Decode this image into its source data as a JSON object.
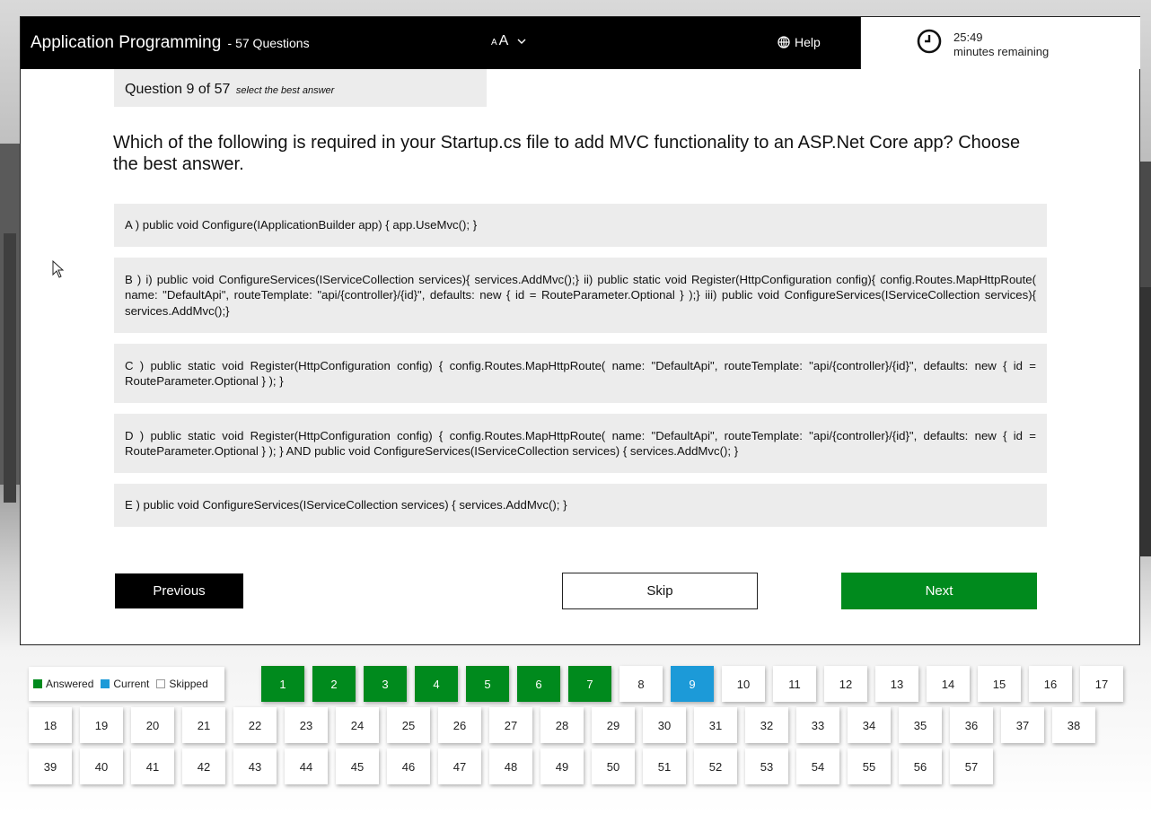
{
  "header": {
    "title": "Application Programming",
    "subtitle": "- 57 Questions",
    "font_size_small": "A",
    "font_size_big": "A",
    "help_label": "Help",
    "timer_value": "25:49",
    "timer_label": "minutes remaining"
  },
  "question": {
    "label": "Question 9 of 57",
    "hint": "select the best answer",
    "text": "Which of the following is required in your Startup.cs file to add MVC functionality to an ASP.Net Core app? Choose the best answer."
  },
  "options": [
    "A ) public void Configure(IApplicationBuilder app) { app.UseMvc(); }",
    "B ) i) public void ConfigureServices(IServiceCollection services){ services.AddMvc();} ii) public static void Register(HttpConfiguration config){ config.Routes.MapHttpRoute( name: \"DefaultApi\", routeTemplate: \"api/{controller}/{id}\", defaults: new { id = RouteParameter.Optional } );} iii) public void ConfigureServices(IServiceCollection services){ services.AddMvc();}",
    "C ) public static void Register(HttpConfiguration config) { config.Routes.MapHttpRoute( name: \"DefaultApi\", routeTemplate: \"api/{controller}/{id}\", defaults: new { id = RouteParameter.Optional } ); }",
    "D ) public static void Register(HttpConfiguration config) { config.Routes.MapHttpRoute( name: \"DefaultApi\", routeTemplate: \"api/{controller}/{id}\", defaults: new { id = RouteParameter.Optional } ); }  AND   public void ConfigureServices(IServiceCollection services) { services.AddMvc(); }",
    "E ) public void ConfigureServices(IServiceCollection services) { services.AddMvc(); }"
  ],
  "nav": {
    "previous_label": "Previous",
    "skip_label": "Skip",
    "next_label": "Next"
  },
  "legend": {
    "answered_label": "Answered",
    "current_label": "Current",
    "skipped_label": "Skipped"
  },
  "palette": {
    "answered_color": "#008a1d",
    "current_color": "#1c9ad8"
  },
  "question_grid": {
    "answered": [
      1,
      2,
      3,
      4,
      5,
      6,
      7
    ],
    "current": 9,
    "numbers": [
      "1",
      "2",
      "3",
      "4",
      "5",
      "6",
      "7",
      "8",
      "9",
      "10",
      "11",
      "12",
      "13",
      "14",
      "15",
      "16",
      "17",
      "18",
      "19",
      "20",
      "21",
      "22",
      "23",
      "24",
      "25",
      "26",
      "27",
      "28",
      "29",
      "30",
      "31",
      "32",
      "33",
      "34",
      "35",
      "36",
      "37",
      "38",
      "39",
      "40",
      "41",
      "42",
      "43",
      "44",
      "45",
      "46",
      "47",
      "48",
      "49",
      "50",
      "51",
      "52",
      "53",
      "54",
      "55",
      "56",
      "57"
    ]
  },
  "icons": {
    "font_size": "chevron-down-icon",
    "help": "globe-icon",
    "timer": "clock-icon"
  }
}
